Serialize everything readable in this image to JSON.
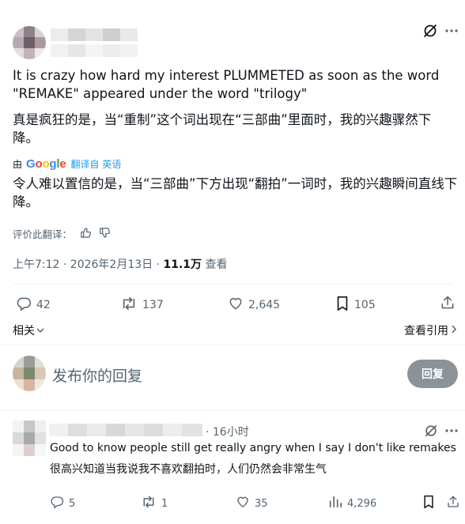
{
  "post": {
    "body_en": "It is crazy how hard my interest PLUMMETED as soon as the word \"REMAKE\" appeared under the word \"trilogy\"",
    "body_zh": "真是疯狂的是，当“重制”这个词出现在“三部曲”里面时，我的兴趣骤然下降。",
    "translated_by_prefix": "由",
    "google_label": "Google",
    "translate_label": "翻译自 英语",
    "alt_translation": "令人难以置信的是，当“三部曲”下方出现“翻拍”一词时，我的兴趣瞬间直线下降。",
    "rate_translation": "评价此翻译：",
    "timestamp": "上午7:12 · 2026年2月13日 · ",
    "views_count": "11.1万",
    "views_label": " 查看",
    "replies": "42",
    "reposts": "137",
    "likes": "2,645",
    "bookmarks": "105",
    "related_label": "相关",
    "view_quotes": "查看引用"
  },
  "composer": {
    "placeholder": "发布你的回复",
    "reply_button": "回复"
  },
  "reply": {
    "time": "· 16小时",
    "body_en": "Good to know people still get really angry when I say I don't like remakes",
    "body_zh": "很高兴知道当我说我不喜欢翻拍时，人们仍然会非常生气",
    "replies": "5",
    "reposts": "1",
    "likes": "35",
    "views": "4,296"
  },
  "colors": {
    "text": "#0f1419",
    "muted": "#536471",
    "divider": "#eff3f4",
    "link": "#1d9bf0",
    "button_disabled": "#8b9298"
  },
  "icons": [
    "grok-icon",
    "more-icon",
    "thumbs-up-icon",
    "thumbs-down-icon",
    "reply-icon",
    "repost-icon",
    "like-icon",
    "bookmark-icon",
    "share-icon",
    "chevron-down-icon",
    "chevron-right-icon",
    "views-icon"
  ]
}
